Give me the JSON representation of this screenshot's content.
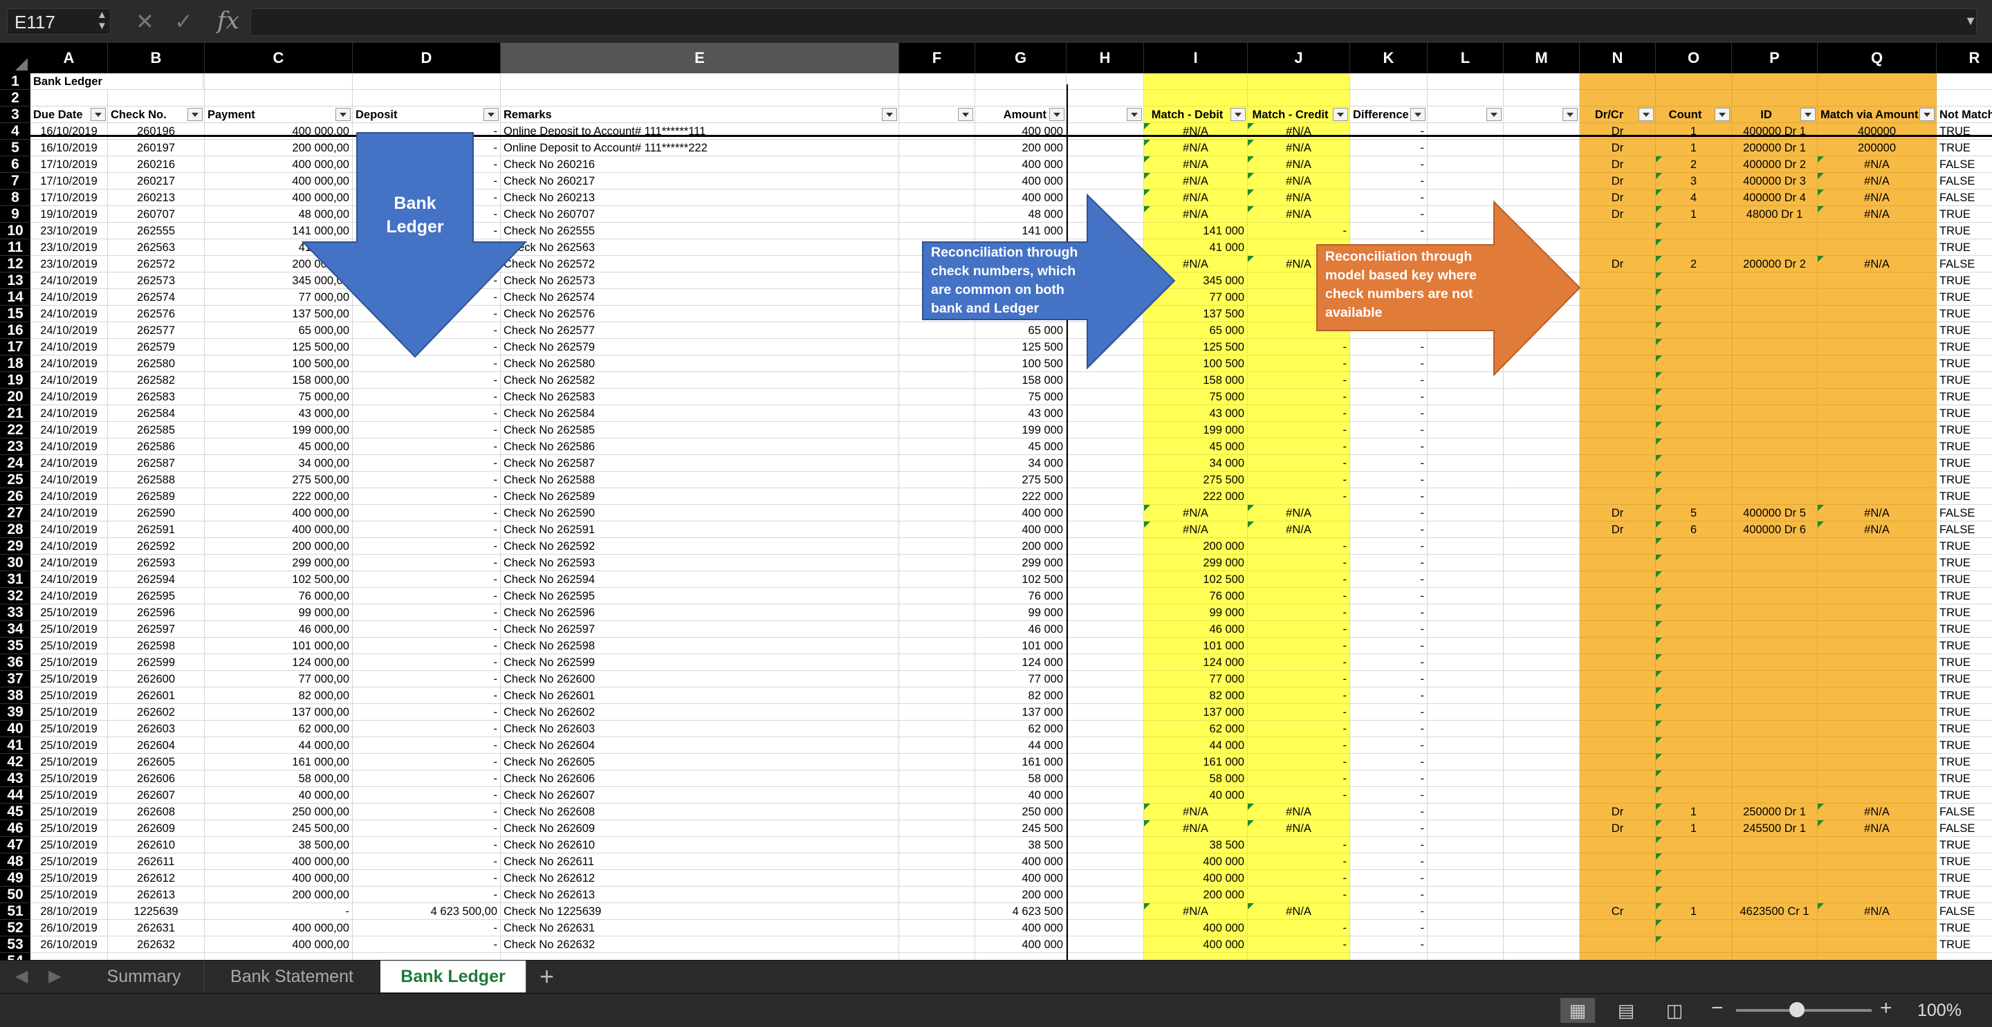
{
  "formula_bar": {
    "name_box": "E117",
    "fx_label": "fx",
    "formula": ""
  },
  "columns": [
    "A",
    "B",
    "C",
    "D",
    "E",
    "F",
    "G",
    "H",
    "I",
    "J",
    "K",
    "L",
    "M",
    "N",
    "O",
    "P",
    "Q",
    "R"
  ],
  "selected_column": "E",
  "title": "Bank Ledger",
  "headers": {
    "A": "Due Date",
    "B": "Check No.",
    "C": "Payment",
    "D": "Deposit",
    "E": "Remarks",
    "G": "Amount",
    "I": "Match - Debit",
    "J": "Match - Credit",
    "K": "Difference",
    "N": "Dr/Cr",
    "O": "Count",
    "P": "ID",
    "Q": "Match via Amount",
    "R": "Not Match"
  },
  "rows": [
    {
      "n": 4,
      "date": "16/10/2019",
      "chk": "260196",
      "pay": "400 000,00",
      "dep": "-",
      "rem": "Online Deposit to Account# 111******111",
      "amt": "400 000",
      "i": "#N/A",
      "j": "#N/A",
      "k": "-",
      "n_": "Dr",
      "o": "1",
      "p": "400000 Dr 1",
      "q": "400000",
      "r": "TRUE"
    },
    {
      "n": 5,
      "date": "16/10/2019",
      "chk": "260197",
      "pay": "200 000,00",
      "dep": "-",
      "rem": "Online Deposit to Account# 111******222",
      "amt": "200 000",
      "i": "#N/A",
      "j": "#N/A",
      "k": "-",
      "n_": "Dr",
      "o": "1",
      "p": "200000 Dr 1",
      "q": "200000",
      "r": "TRUE"
    },
    {
      "n": 6,
      "date": "17/10/2019",
      "chk": "260216",
      "pay": "400 000,00",
      "dep": "-",
      "rem": "Check No 260216",
      "amt": "400 000",
      "i": "#N/A",
      "j": "#N/A",
      "k": "-",
      "n_": "Dr",
      "o": "2",
      "p": "400000 Dr 2",
      "q": "#N/A",
      "r": "FALSE"
    },
    {
      "n": 7,
      "date": "17/10/2019",
      "chk": "260217",
      "pay": "400 000,00",
      "dep": "-",
      "rem": "Check No 260217",
      "amt": "400 000",
      "i": "#N/A",
      "j": "#N/A",
      "k": "-",
      "n_": "Dr",
      "o": "3",
      "p": "400000 Dr 3",
      "q": "#N/A",
      "r": "FALSE"
    },
    {
      "n": 8,
      "date": "17/10/2019",
      "chk": "260213",
      "pay": "400 000,00",
      "dep": "-",
      "rem": "Check No 260213",
      "amt": "400 000",
      "i": "#N/A",
      "j": "#N/A",
      "k": "-",
      "n_": "Dr",
      "o": "4",
      "p": "400000 Dr 4",
      "q": "#N/A",
      "r": "FALSE"
    },
    {
      "n": 9,
      "date": "19/10/2019",
      "chk": "260707",
      "pay": "48 000,00",
      "dep": "-",
      "rem": "Check No 260707",
      "amt": "48 000",
      "i": "#N/A",
      "j": "#N/A",
      "k": "-",
      "n_": "Dr",
      "o": "1",
      "p": "48000 Dr 1",
      "q": "#N/A",
      "r": "TRUE"
    },
    {
      "n": 10,
      "date": "23/10/2019",
      "chk": "262555",
      "pay": "141 000,00",
      "dep": "-",
      "rem": "Check No 262555",
      "amt": "141 000",
      "i": "141 000",
      "j": "-",
      "k": "-",
      "n_": "",
      "o": "",
      "p": "",
      "q": "",
      "r": "TRUE"
    },
    {
      "n": 11,
      "date": "23/10/2019",
      "chk": "262563",
      "pay": "41 000,00",
      "dep": "-",
      "rem": "Check No 262563",
      "amt": "41 000",
      "i": "41 000",
      "j": "-",
      "k": "-",
      "n_": "",
      "o": "",
      "p": "",
      "q": "",
      "r": "TRUE"
    },
    {
      "n": 12,
      "date": "23/10/2019",
      "chk": "262572",
      "pay": "200 000,00",
      "dep": "-",
      "rem": "Check No 262572",
      "amt": "200 000",
      "i": "#N/A",
      "j": "#N/A",
      "k": "-",
      "n_": "Dr",
      "o": "2",
      "p": "200000 Dr 2",
      "q": "#N/A",
      "r": "FALSE"
    },
    {
      "n": 13,
      "date": "24/10/2019",
      "chk": "262573",
      "pay": "345 000,00",
      "dep": "-",
      "rem": "Check No 262573",
      "amt": "345 000",
      "i": "345 000",
      "j": "-",
      "k": "-",
      "n_": "",
      "o": "",
      "p": "",
      "q": "",
      "r": "TRUE"
    },
    {
      "n": 14,
      "date": "24/10/2019",
      "chk": "262574",
      "pay": "77 000,00",
      "dep": "-",
      "rem": "Check No 262574",
      "amt": "77 000",
      "i": "77 000",
      "j": "-",
      "k": "-",
      "n_": "",
      "o": "",
      "p": "",
      "q": "",
      "r": "TRUE"
    },
    {
      "n": 15,
      "date": "24/10/2019",
      "chk": "262576",
      "pay": "137 500,00",
      "dep": "-",
      "rem": "Check No 262576",
      "amt": "137 500",
      "i": "137 500",
      "j": "-",
      "k": "-",
      "n_": "",
      "o": "",
      "p": "",
      "q": "",
      "r": "TRUE"
    },
    {
      "n": 16,
      "date": "24/10/2019",
      "chk": "262577",
      "pay": "65 000,00",
      "dep": "-",
      "rem": "Check No 262577",
      "amt": "65 000",
      "i": "65 000",
      "j": "-",
      "k": "-",
      "n_": "",
      "o": "",
      "p": "",
      "q": "",
      "r": "TRUE"
    },
    {
      "n": 17,
      "date": "24/10/2019",
      "chk": "262579",
      "pay": "125 500,00",
      "dep": "-",
      "rem": "Check No 262579",
      "amt": "125 500",
      "i": "125 500",
      "j": "-",
      "k": "-",
      "n_": "",
      "o": "",
      "p": "",
      "q": "",
      "r": "TRUE"
    },
    {
      "n": 18,
      "date": "24/10/2019",
      "chk": "262580",
      "pay": "100 500,00",
      "dep": "-",
      "rem": "Check No 262580",
      "amt": "100 500",
      "i": "100 500",
      "j": "-",
      "k": "-",
      "n_": "",
      "o": "",
      "p": "",
      "q": "",
      "r": "TRUE"
    },
    {
      "n": 19,
      "date": "24/10/2019",
      "chk": "262582",
      "pay": "158 000,00",
      "dep": "-",
      "rem": "Check No 262582",
      "amt": "158 000",
      "i": "158 000",
      "j": "-",
      "k": "-",
      "n_": "",
      "o": "",
      "p": "",
      "q": "",
      "r": "TRUE"
    },
    {
      "n": 20,
      "date": "24/10/2019",
      "chk": "262583",
      "pay": "75 000,00",
      "dep": "-",
      "rem": "Check No 262583",
      "amt": "75 000",
      "i": "75 000",
      "j": "-",
      "k": "-",
      "n_": "",
      "o": "",
      "p": "",
      "q": "",
      "r": "TRUE"
    },
    {
      "n": 21,
      "date": "24/10/2019",
      "chk": "262584",
      "pay": "43 000,00",
      "dep": "-",
      "rem": "Check No 262584",
      "amt": "43 000",
      "i": "43 000",
      "j": "-",
      "k": "-",
      "n_": "",
      "o": "",
      "p": "",
      "q": "",
      "r": "TRUE"
    },
    {
      "n": 22,
      "date": "24/10/2019",
      "chk": "262585",
      "pay": "199 000,00",
      "dep": "-",
      "rem": "Check No 262585",
      "amt": "199 000",
      "i": "199 000",
      "j": "-",
      "k": "-",
      "n_": "",
      "o": "",
      "p": "",
      "q": "",
      "r": "TRUE"
    },
    {
      "n": 23,
      "date": "24/10/2019",
      "chk": "262586",
      "pay": "45 000,00",
      "dep": "-",
      "rem": "Check No 262586",
      "amt": "45 000",
      "i": "45 000",
      "j": "-",
      "k": "-",
      "n_": "",
      "o": "",
      "p": "",
      "q": "",
      "r": "TRUE"
    },
    {
      "n": 24,
      "date": "24/10/2019",
      "chk": "262587",
      "pay": "34 000,00",
      "dep": "-",
      "rem": "Check No 262587",
      "amt": "34 000",
      "i": "34 000",
      "j": "-",
      "k": "-",
      "n_": "",
      "o": "",
      "p": "",
      "q": "",
      "r": "TRUE"
    },
    {
      "n": 25,
      "date": "24/10/2019",
      "chk": "262588",
      "pay": "275 500,00",
      "dep": "-",
      "rem": "Check No 262588",
      "amt": "275 500",
      "i": "275 500",
      "j": "-",
      "k": "-",
      "n_": "",
      "o": "",
      "p": "",
      "q": "",
      "r": "TRUE"
    },
    {
      "n": 26,
      "date": "24/10/2019",
      "chk": "262589",
      "pay": "222 000,00",
      "dep": "-",
      "rem": "Check No 262589",
      "amt": "222 000",
      "i": "222 000",
      "j": "-",
      "k": "-",
      "n_": "",
      "o": "",
      "p": "",
      "q": "",
      "r": "TRUE"
    },
    {
      "n": 27,
      "date": "24/10/2019",
      "chk": "262590",
      "pay": "400 000,00",
      "dep": "-",
      "rem": "Check No 262590",
      "amt": "400 000",
      "i": "#N/A",
      "j": "#N/A",
      "k": "-",
      "n_": "Dr",
      "o": "5",
      "p": "400000 Dr 5",
      "q": "#N/A",
      "r": "FALSE"
    },
    {
      "n": 28,
      "date": "24/10/2019",
      "chk": "262591",
      "pay": "400 000,00",
      "dep": "-",
      "rem": "Check No 262591",
      "amt": "400 000",
      "i": "#N/A",
      "j": "#N/A",
      "k": "-",
      "n_": "Dr",
      "o": "6",
      "p": "400000 Dr 6",
      "q": "#N/A",
      "r": "FALSE"
    },
    {
      "n": 29,
      "date": "24/10/2019",
      "chk": "262592",
      "pay": "200 000,00",
      "dep": "-",
      "rem": "Check No 262592",
      "amt": "200 000",
      "i": "200 000",
      "j": "-",
      "k": "-",
      "n_": "",
      "o": "",
      "p": "",
      "q": "",
      "r": "TRUE"
    },
    {
      "n": 30,
      "date": "24/10/2019",
      "chk": "262593",
      "pay": "299 000,00",
      "dep": "-",
      "rem": "Check No 262593",
      "amt": "299 000",
      "i": "299 000",
      "j": "-",
      "k": "-",
      "n_": "",
      "o": "",
      "p": "",
      "q": "",
      "r": "TRUE"
    },
    {
      "n": 31,
      "date": "24/10/2019",
      "chk": "262594",
      "pay": "102 500,00",
      "dep": "-",
      "rem": "Check No 262594",
      "amt": "102 500",
      "i": "102 500",
      "j": "-",
      "k": "-",
      "n_": "",
      "o": "",
      "p": "",
      "q": "",
      "r": "TRUE"
    },
    {
      "n": 32,
      "date": "24/10/2019",
      "chk": "262595",
      "pay": "76 000,00",
      "dep": "-",
      "rem": "Check No 262595",
      "amt": "76 000",
      "i": "76 000",
      "j": "-",
      "k": "-",
      "n_": "",
      "o": "",
      "p": "",
      "q": "",
      "r": "TRUE"
    },
    {
      "n": 33,
      "date": "25/10/2019",
      "chk": "262596",
      "pay": "99 000,00",
      "dep": "-",
      "rem": "Check No 262596",
      "amt": "99 000",
      "i": "99 000",
      "j": "-",
      "k": "-",
      "n_": "",
      "o": "",
      "p": "",
      "q": "",
      "r": "TRUE"
    },
    {
      "n": 34,
      "date": "25/10/2019",
      "chk": "262597",
      "pay": "46 000,00",
      "dep": "-",
      "rem": "Check No 262597",
      "amt": "46 000",
      "i": "46 000",
      "j": "-",
      "k": "-",
      "n_": "",
      "o": "",
      "p": "",
      "q": "",
      "r": "TRUE"
    },
    {
      "n": 35,
      "date": "25/10/2019",
      "chk": "262598",
      "pay": "101 000,00",
      "dep": "-",
      "rem": "Check No 262598",
      "amt": "101 000",
      "i": "101 000",
      "j": "-",
      "k": "-",
      "n_": "",
      "o": "",
      "p": "",
      "q": "",
      "r": "TRUE"
    },
    {
      "n": 36,
      "date": "25/10/2019",
      "chk": "262599",
      "pay": "124 000,00",
      "dep": "-",
      "rem": "Check No 262599",
      "amt": "124 000",
      "i": "124 000",
      "j": "-",
      "k": "-",
      "n_": "",
      "o": "",
      "p": "",
      "q": "",
      "r": "TRUE"
    },
    {
      "n": 37,
      "date": "25/10/2019",
      "chk": "262600",
      "pay": "77 000,00",
      "dep": "-",
      "rem": "Check No 262600",
      "amt": "77 000",
      "i": "77 000",
      "j": "-",
      "k": "-",
      "n_": "",
      "o": "",
      "p": "",
      "q": "",
      "r": "TRUE"
    },
    {
      "n": 38,
      "date": "25/10/2019",
      "chk": "262601",
      "pay": "82 000,00",
      "dep": "-",
      "rem": "Check No 262601",
      "amt": "82 000",
      "i": "82 000",
      "j": "-",
      "k": "-",
      "n_": "",
      "o": "",
      "p": "",
      "q": "",
      "r": "TRUE"
    },
    {
      "n": 39,
      "date": "25/10/2019",
      "chk": "262602",
      "pay": "137 000,00",
      "dep": "-",
      "rem": "Check No 262602",
      "amt": "137 000",
      "i": "137 000",
      "j": "-",
      "k": "-",
      "n_": "",
      "o": "",
      "p": "",
      "q": "",
      "r": "TRUE"
    },
    {
      "n": 40,
      "date": "25/10/2019",
      "chk": "262603",
      "pay": "62 000,00",
      "dep": "-",
      "rem": "Check No 262603",
      "amt": "62 000",
      "i": "62 000",
      "j": "-",
      "k": "-",
      "n_": "",
      "o": "",
      "p": "",
      "q": "",
      "r": "TRUE"
    },
    {
      "n": 41,
      "date": "25/10/2019",
      "chk": "262604",
      "pay": "44 000,00",
      "dep": "-",
      "rem": "Check No 262604",
      "amt": "44 000",
      "i": "44 000",
      "j": "-",
      "k": "-",
      "n_": "",
      "o": "",
      "p": "",
      "q": "",
      "r": "TRUE"
    },
    {
      "n": 42,
      "date": "25/10/2019",
      "chk": "262605",
      "pay": "161 000,00",
      "dep": "-",
      "rem": "Check No 262605",
      "amt": "161 000",
      "i": "161 000",
      "j": "-",
      "k": "-",
      "n_": "",
      "o": "",
      "p": "",
      "q": "",
      "r": "TRUE"
    },
    {
      "n": 43,
      "date": "25/10/2019",
      "chk": "262606",
      "pay": "58 000,00",
      "dep": "-",
      "rem": "Check No 262606",
      "amt": "58 000",
      "i": "58 000",
      "j": "-",
      "k": "-",
      "n_": "",
      "o": "",
      "p": "",
      "q": "",
      "r": "TRUE"
    },
    {
      "n": 44,
      "date": "25/10/2019",
      "chk": "262607",
      "pay": "40 000,00",
      "dep": "-",
      "rem": "Check No 262607",
      "amt": "40 000",
      "i": "40 000",
      "j": "-",
      "k": "-",
      "n_": "",
      "o": "",
      "p": "",
      "q": "",
      "r": "TRUE"
    },
    {
      "n": 45,
      "date": "25/10/2019",
      "chk": "262608",
      "pay": "250 000,00",
      "dep": "-",
      "rem": "Check No 262608",
      "amt": "250 000",
      "i": "#N/A",
      "j": "#N/A",
      "k": "-",
      "n_": "Dr",
      "o": "1",
      "p": "250000 Dr 1",
      "q": "#N/A",
      "r": "FALSE"
    },
    {
      "n": 46,
      "date": "25/10/2019",
      "chk": "262609",
      "pay": "245 500,00",
      "dep": "-",
      "rem": "Check No 262609",
      "amt": "245 500",
      "i": "#N/A",
      "j": "#N/A",
      "k": "-",
      "n_": "Dr",
      "o": "1",
      "p": "245500 Dr 1",
      "q": "#N/A",
      "r": "FALSE"
    },
    {
      "n": 47,
      "date": "25/10/2019",
      "chk": "262610",
      "pay": "38 500,00",
      "dep": "-",
      "rem": "Check No 262610",
      "amt": "38 500",
      "i": "38 500",
      "j": "-",
      "k": "-",
      "n_": "",
      "o": "",
      "p": "",
      "q": "",
      "r": "TRUE"
    },
    {
      "n": 48,
      "date": "25/10/2019",
      "chk": "262611",
      "pay": "400 000,00",
      "dep": "-",
      "rem": "Check No 262611",
      "amt": "400 000",
      "i": "400 000",
      "j": "-",
      "k": "-",
      "n_": "",
      "o": "",
      "p": "",
      "q": "",
      "r": "TRUE"
    },
    {
      "n": 49,
      "date": "25/10/2019",
      "chk": "262612",
      "pay": "400 000,00",
      "dep": "-",
      "rem": "Check No 262612",
      "amt": "400 000",
      "i": "400 000",
      "j": "-",
      "k": "-",
      "n_": "",
      "o": "",
      "p": "",
      "q": "",
      "r": "TRUE"
    },
    {
      "n": 50,
      "date": "25/10/2019",
      "chk": "262613",
      "pay": "200 000,00",
      "dep": "-",
      "rem": "Check No 262613",
      "amt": "200 000",
      "i": "200 000",
      "j": "-",
      "k": "-",
      "n_": "",
      "o": "",
      "p": "",
      "q": "",
      "r": "TRUE"
    },
    {
      "n": 51,
      "date": "28/10/2019",
      "chk": "1225639",
      "pay": "-",
      "dep": "4 623 500,00",
      "rem": "Check No 1225639",
      "amt": "4 623 500",
      "i": "#N/A",
      "j": "#N/A",
      "k": "-",
      "n_": "Cr",
      "o": "1",
      "p": "4623500 Cr 1",
      "q": "#N/A",
      "r": "FALSE"
    },
    {
      "n": 52,
      "date": "26/10/2019",
      "chk": "262631",
      "pay": "400 000,00",
      "dep": "-",
      "rem": "Check No 262631",
      "amt": "400 000",
      "i": "400 000",
      "j": "-",
      "k": "-",
      "n_": "",
      "o": "",
      "p": "",
      "q": "",
      "r": "TRUE"
    },
    {
      "n": 53,
      "date": "26/10/2019",
      "chk": "262632",
      "pay": "400 000,00",
      "dep": "-",
      "rem": "Check No 262632",
      "amt": "400 000",
      "i": "400 000",
      "j": "-",
      "k": "-",
      "n_": "",
      "o": "",
      "p": "",
      "q": "",
      "r": "TRUE"
    }
  ],
  "callouts": {
    "bank_ledger": "Bank Ledger",
    "check_numbers": "Reconciliation through check numbers, which are common on both bank and Ledger",
    "model_key": "Reconciliation through model based key where check numbers are not available"
  },
  "callout_colors": {
    "blue": "#4472c4",
    "orange": "#e07b3a",
    "yellow": "#ffff55",
    "gold": "#f7bb45"
  },
  "sheet_tabs": [
    {
      "label": "Summary"
    },
    {
      "label": "Bank Statement"
    },
    {
      "label": "Bank Ledger",
      "active": true
    }
  ],
  "add_sheet_label": "+",
  "status": {
    "zoom": "100%",
    "zoom_fraction": 0.45
  }
}
